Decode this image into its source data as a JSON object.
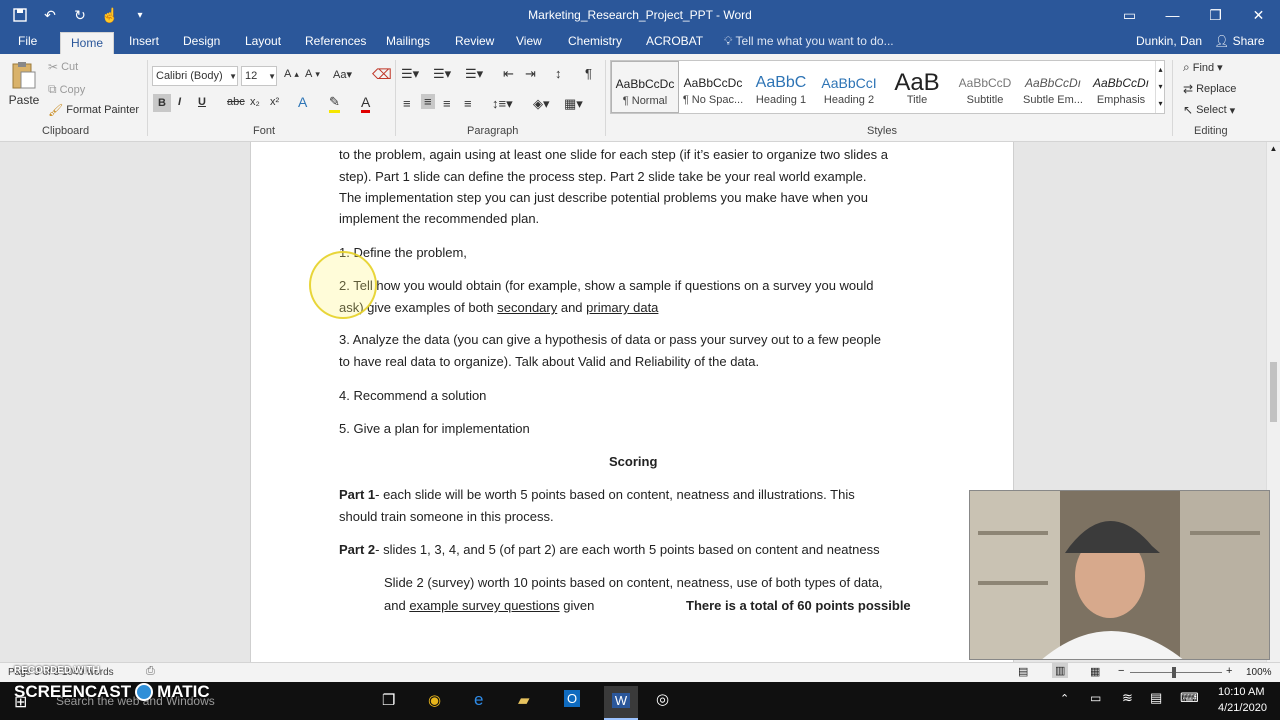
{
  "titlebar": {
    "title": "Marketing_Research_Project_PPT - Word",
    "qat": [
      "save-icon",
      "undo-icon",
      "redo-icon",
      "touch-icon",
      "customize-icon"
    ]
  },
  "tabs": [
    "File",
    "Home",
    "Insert",
    "Design",
    "Layout",
    "References",
    "Mailings",
    "Review",
    "View",
    "Chemistry",
    "ACROBAT"
  ],
  "active_tab": "Home",
  "tellme": "Tell me what you want to do...",
  "user": "Dunkin, Dan",
  "share": "Share",
  "clipboard": {
    "paste": "Paste",
    "cut": "Cut",
    "copy": "Copy",
    "format_painter": "Format Painter",
    "label": "Clipboard"
  },
  "font": {
    "name": "Calibri (Body)",
    "size": "12",
    "label": "Font",
    "bold": "B",
    "italic": "I",
    "underline": "U",
    "strike": "abc",
    "sub": "x₂",
    "sup": "x²"
  },
  "paragraph": {
    "label": "Paragraph"
  },
  "styles": {
    "label": "Styles",
    "items": [
      {
        "preview": "AaBbCcDc",
        "name": "¶ Normal"
      },
      {
        "preview": "AaBbCcDc",
        "name": "¶ No Spac..."
      },
      {
        "preview": "AaBbC",
        "name": "Heading 1"
      },
      {
        "preview": "AaBbCcI",
        "name": "Heading 2"
      },
      {
        "preview": "AaB",
        "name": "Title"
      },
      {
        "preview": "AaBbCcD",
        "name": "Subtitle"
      },
      {
        "preview": "AaBbCcDı",
        "name": "Subtle Em..."
      },
      {
        "preview": "AaBbCcDı",
        "name": "Emphasis"
      }
    ]
  },
  "editing": {
    "find": "Find",
    "replace": "Replace",
    "select": "Select",
    "label": "Editing"
  },
  "document": {
    "lines": [
      "to the problem, again using at least one slide for each step (if it’s easier to organize two slides a",
      "step).  Part 1 slide can define the process step.  Part 2 slide take be your real world example.",
      "The implementation step you can just describe potential problems you make have when you",
      "implement the recommended plan."
    ],
    "item1": "1. Define the problem,",
    "item2a": "2. Tell how you would obtain (for example, show a sample if questions on a survey you would",
    "item2b_pre": "ask) give examples of both ",
    "item2b_u1": "secondary",
    "item2b_mid": " and ",
    "item2b_u2": "primary data",
    "item3a": "3. Analyze the data (you can give a hypothesis of data or pass your survey out to a few people",
    "item3b": "to have real data to organize). Talk about Valid and Reliability of the data.",
    "item4": "4. Recommend a solution",
    "item5": "5. Give a plan for implementation",
    "scoring": "Scoring",
    "part1_label": "Part 1",
    "part1_a": "- each slide will be worth 5 points based on content, neatness and illustrations.  This",
    "part1_b": "should train someone in this process.",
    "part2_label": "Part 2",
    "part2_a": "- slides 1, 3, 4, and 5 (of part 2) are each worth 5 points based on content and neatness",
    "slide2_a": "Slide 2 (survey) worth 10 points based on content, neatness, use of both types of data,",
    "slide2_b_pre": "and ",
    "slide2_b_u": "example survey questions",
    "slide2_b_post": " given",
    "total": "There is a total of 60 points possible"
  },
  "status": {
    "words": "Page 3 of 3   1049 words",
    "zoom": "100%"
  },
  "watermark": {
    "recorded": "RECORDED WITH",
    "brand_left": "SCREENCAST",
    "brand_right": "MATIC"
  },
  "taskbar": {
    "search": "Search the web and Windows",
    "time": "10:10 AM",
    "date": "4/21/2020"
  }
}
